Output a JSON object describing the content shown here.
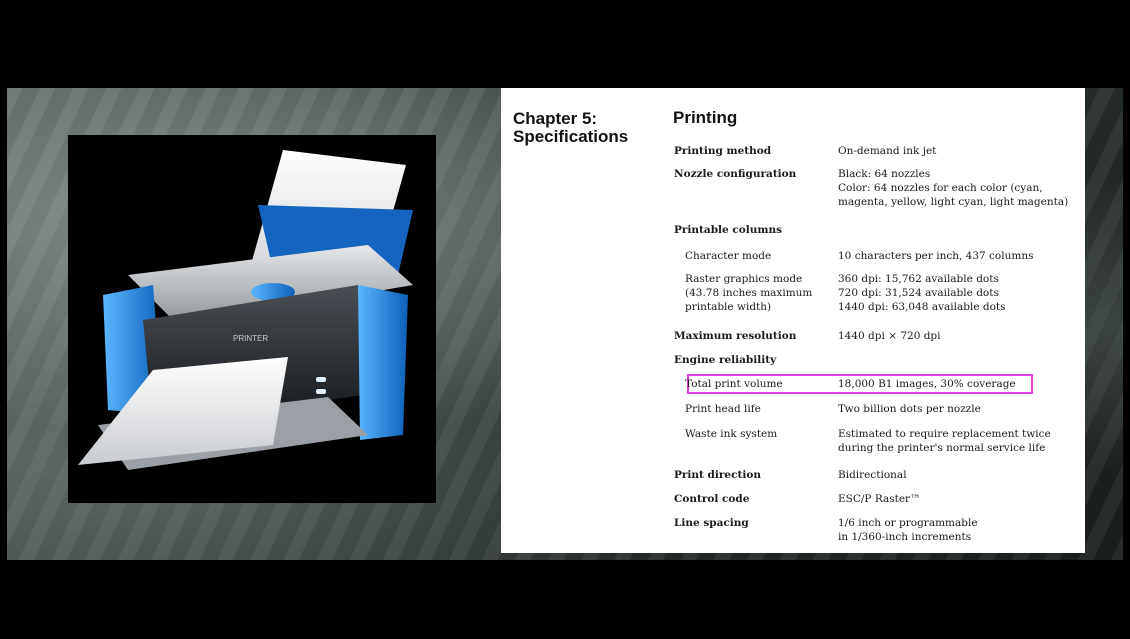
{
  "slide": {
    "chapter": "Chapter 5:\nSpecifications",
    "section": "Printing",
    "printer_label": "PRINTER"
  },
  "specs": [
    {
      "label": "Printing method",
      "style": "bold",
      "value": "On-demand ink jet"
    },
    {
      "label": "Nozzle configuration",
      "style": "bold",
      "value": "Black: 64 nozzles\nColor: 64 nozzles for each color (cyan,\nmagenta, yellow, light cyan, light magenta)"
    },
    {
      "label": "Printable columns",
      "style": "bold",
      "value": ""
    },
    {
      "label": "Character mode",
      "style": "sub",
      "value": "10 characters per inch, 437 columns"
    },
    {
      "label": "Raster graphics mode\n(43.78 inches maximum\nprintable width)",
      "style": "sub",
      "value": "360 dpi: 15,762 available dots\n720 dpi: 31,524 available dots\n1440 dpi: 63,048 available dots"
    },
    {
      "label": "Maximum resolution",
      "style": "bold",
      "value": "1440 dpi × 720 dpi"
    },
    {
      "label": "Engine reliability",
      "style": "bold",
      "value": ""
    },
    {
      "label": "Total print volume",
      "style": "sub",
      "value": "18,000 B1 images, 30% coverage",
      "highlighted": true
    },
    {
      "label": "Print head life",
      "style": "sub",
      "value": "Two billion dots per nozzle"
    },
    {
      "label": "Waste ink system",
      "style": "sub",
      "value": "Estimated to require replacement twice\nduring the printer's normal service life"
    },
    {
      "label": "Print direction",
      "style": "bold",
      "value": "Bidirectional"
    },
    {
      "label": "Control code",
      "style": "bold",
      "value": "ESC/P Raster™"
    },
    {
      "label": "Line spacing",
      "style": "bold",
      "value": "1/6 inch or programmable\nin 1/360-inch increments"
    }
  ],
  "colors": {
    "highlight": "#e040e0",
    "printer_blue": "#1e88e5"
  }
}
